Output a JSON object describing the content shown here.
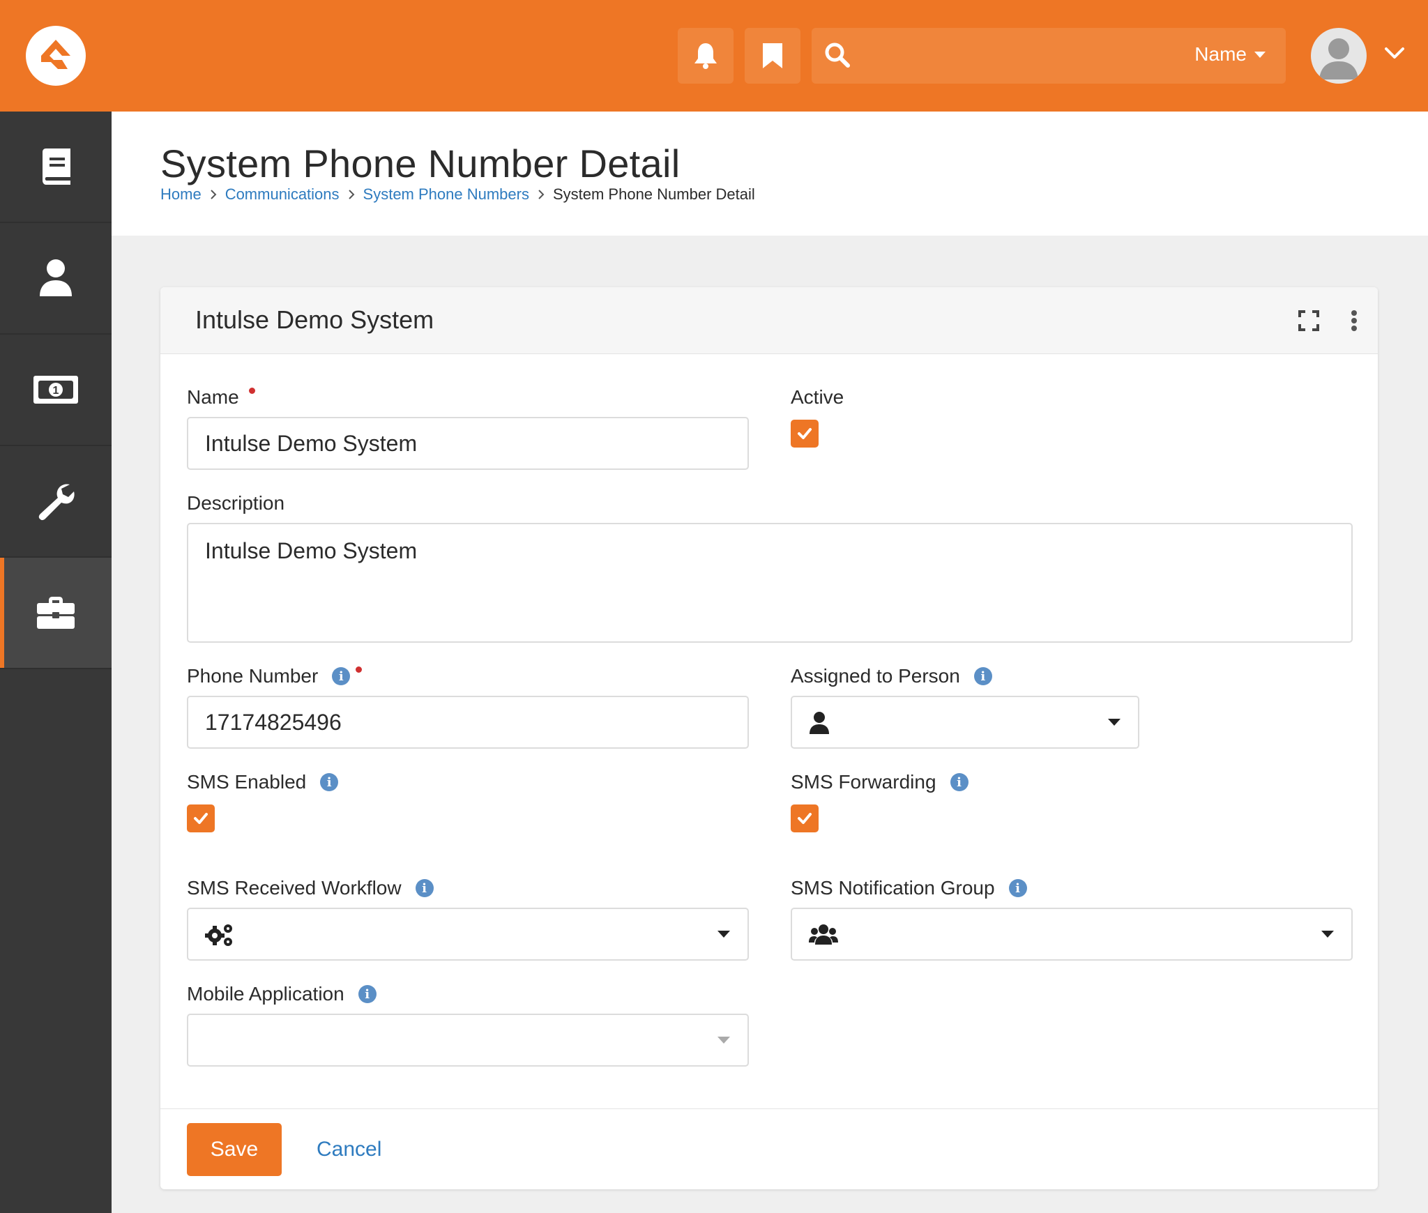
{
  "colors": {
    "brand": "#ee7625",
    "sidebar": "#383838",
    "link": "#2e7bbf",
    "info": "#5b8fc6",
    "required": "#d03030"
  },
  "topbar": {
    "search_filter_label": "Name",
    "search_placeholder": ""
  },
  "sidebar": {
    "items": [
      {
        "icon": "book-icon"
      },
      {
        "icon": "person-icon"
      },
      {
        "icon": "money-icon"
      },
      {
        "icon": "wrench-icon"
      },
      {
        "icon": "briefcase-icon",
        "active": true
      }
    ]
  },
  "page": {
    "title": "System Phone Number Detail",
    "breadcrumb": [
      "Home",
      "Communications",
      "System Phone Numbers",
      "System Phone Number Detail"
    ]
  },
  "panel": {
    "title": "Intulse Demo System"
  },
  "form": {
    "name_label": "Name",
    "name_value": "Intulse Demo System",
    "active_label": "Active",
    "active_checked": true,
    "description_label": "Description",
    "description_value": "Intulse Demo System",
    "phone_label": "Phone Number",
    "phone_value": "17174825496",
    "assigned_label": "Assigned to Person",
    "sms_enabled_label": "SMS Enabled",
    "sms_enabled_checked": true,
    "sms_forwarding_label": "SMS Forwarding",
    "sms_forwarding_checked": true,
    "sms_workflow_label": "SMS Received Workflow",
    "sms_group_label": "SMS Notification Group",
    "mobile_app_label": "Mobile Application",
    "info_glyph": "i"
  },
  "actions": {
    "save_label": "Save",
    "cancel_label": "Cancel"
  }
}
